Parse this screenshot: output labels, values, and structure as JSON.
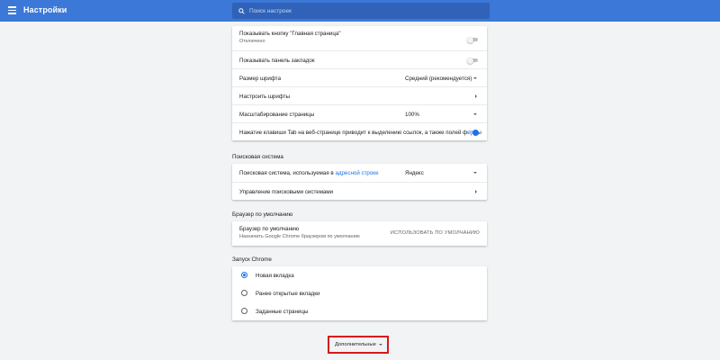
{
  "header": {
    "title": "Настройки",
    "search_placeholder": "Поиск настроек",
    "menu_icon": "hamburger-menu-icon",
    "search_icon": "search-icon",
    "bg_color": "#3c78d8"
  },
  "appearance": {
    "home_button": {
      "label": "Показывать кнопку \"Главная страница\"",
      "sublabel": "Отключено",
      "enabled": false
    },
    "bookmarks_bar": {
      "label": "Показывать панель закладок",
      "enabled": false
    },
    "font_size": {
      "label": "Размер шрифта",
      "value": "Средний (рекомендуется)"
    },
    "customize_fonts": {
      "label": "Настроить шрифты"
    },
    "page_zoom": {
      "label": "Масштабирование страницы",
      "value": "100%"
    },
    "tab_highlight": {
      "label": "Нажатие клавиши Tab на веб-странице приводит к выделению ссылок, а также полей формы",
      "enabled": true
    }
  },
  "search_engine": {
    "title": "Поисковая система",
    "engine": {
      "label_prefix": "Поисковая система, используемая в",
      "label_link": "адресной строке",
      "value": "Яндекс"
    },
    "manage": {
      "label": "Управление поисковыми системами"
    }
  },
  "default_browser": {
    "title": "Браузер по умолчанию",
    "label": "Браузер по умолчанию",
    "sublabel": "Назначить Google Chrome браузером по умолчанию",
    "action": "ИСПОЛЬЗОВАТЬ ПО УМОЛЧАНИЮ"
  },
  "startup": {
    "title": "Запуск Chrome",
    "options": [
      {
        "label": "Новая вкладка",
        "checked": true
      },
      {
        "label": "Ранее открытые вкладки",
        "checked": false
      },
      {
        "label": "Заданные страницы",
        "checked": false
      }
    ]
  },
  "advanced": {
    "label": "Дополнительные",
    "highlight_color": "#d7191c"
  }
}
